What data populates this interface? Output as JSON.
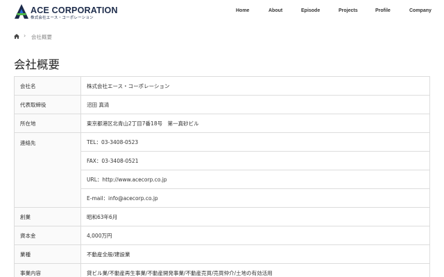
{
  "brand": {
    "name": "ACE CORPORATION",
    "subname": "株式会社エース・コーポレーション",
    "colors": {
      "navy": "#1c2b4a",
      "blue": "#2a6fdb",
      "green": "#4fb848"
    }
  },
  "nav": {
    "items": [
      {
        "label": "Home"
      },
      {
        "label": "About"
      },
      {
        "label": "Episode"
      },
      {
        "label": "Projects"
      },
      {
        "label": "Profile"
      },
      {
        "label": "Company"
      }
    ]
  },
  "breadcrumb": {
    "home_icon": "home-icon",
    "current": "会社概要"
  },
  "page": {
    "title": "会社概要"
  },
  "company": {
    "name_label": "会社名",
    "name_value": "株式会社エース・コーポレーション",
    "rep_label": "代表取締役",
    "rep_value": "沼田 真清",
    "address_label": "所在地",
    "address_value": "東京都港区北青山2丁目7番18号　第一真砂ビル",
    "contact_label": "連絡先",
    "contact": [
      {
        "key": "TEL",
        "value": "03-3408-0523"
      },
      {
        "key": "FAX",
        "value": "03-3408-0521"
      },
      {
        "key": "URL",
        "value": "http://www.acecorp.co.jp"
      },
      {
        "key": "E-mail",
        "value": "info@acecorp.co.jp"
      }
    ],
    "founded_label": "創業",
    "founded_value": "昭和63年6月",
    "capital_label": "資本金",
    "capital_value": "4,000万円",
    "industry_label": "業種",
    "industry_value": "不動産全般/建設業",
    "business_label": "事業内容",
    "business_value": "貸ビル業/不動産再生事業/不動産開発事業/不動産売買/売買仲介/土地の有効活用"
  }
}
